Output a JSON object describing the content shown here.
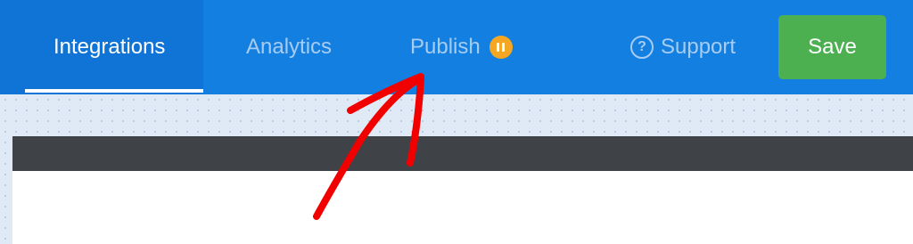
{
  "header": {
    "tabs": [
      {
        "label": "Integrations",
        "active": true
      },
      {
        "label": "Analytics",
        "active": false
      },
      {
        "label": "Publish",
        "active": false,
        "badge_icon": "pause-icon"
      }
    ],
    "support_label": "Support",
    "support_icon": "question-circle-icon",
    "save_label": "Save"
  },
  "annotation": {
    "type": "hand-drawn-arrow",
    "color": "#ff0000",
    "points_to": "Publish"
  },
  "colors": {
    "topbar": "#137fe0",
    "active_tab_bg": "#0f74d6",
    "inactive_text": "#a7ccf2",
    "save_button": "#4caf50",
    "pause_badge": "#f5a623",
    "preview_header": "#3f4347"
  }
}
